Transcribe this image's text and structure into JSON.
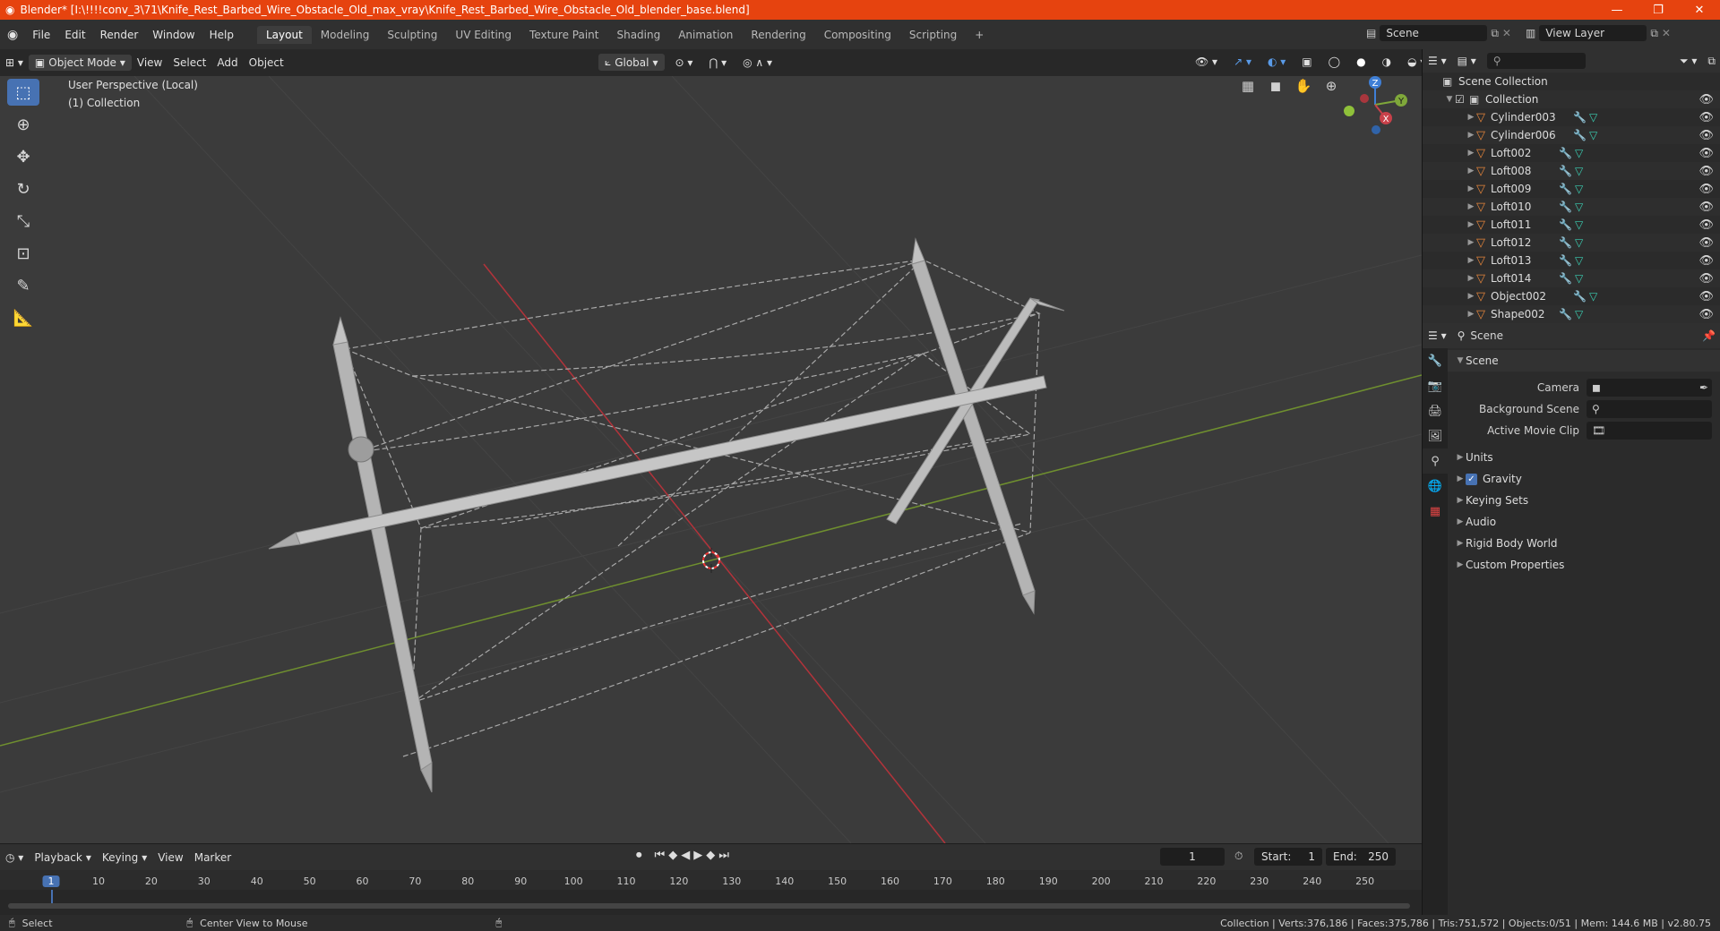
{
  "titlebar": {
    "title": "Blender* [I:\\!!!!conv_3\\71\\Knife_Rest_Barbed_Wire_Obstacle_Old_max_vray\\Knife_Rest_Barbed_Wire_Obstacle_Old_blender_base.blend]",
    "minimize": "—",
    "maximize": "❐",
    "close": "✕"
  },
  "menubar": {
    "items": [
      "File",
      "Edit",
      "Render",
      "Window",
      "Help"
    ],
    "workspaces": [
      "Layout",
      "Modeling",
      "Sculpting",
      "UV Editing",
      "Texture Paint",
      "Shading",
      "Animation",
      "Rendering",
      "Compositing",
      "Scripting"
    ],
    "add_workspace": "+",
    "scene_label": "Scene",
    "view_layer_label": "View Layer"
  },
  "viewport_header": {
    "mode": "Object Mode",
    "menus": [
      "View",
      "Select",
      "Add",
      "Object"
    ],
    "orientation": "Global"
  },
  "viewport": {
    "perspective": "User Perspective (Local)",
    "collection": "(1) Collection",
    "gizmo": {
      "z": "Z",
      "y": "Y",
      "x": "X"
    }
  },
  "outliner": {
    "root": "Scene Collection",
    "collection": "Collection",
    "objects": [
      "Cylinder003",
      "Cylinder006",
      "Loft002",
      "Loft008",
      "Loft009",
      "Loft010",
      "Loft011",
      "Loft012",
      "Loft013",
      "Loft014",
      "Object002",
      "Shape002"
    ]
  },
  "properties": {
    "header": "Scene",
    "panel_title": "Scene",
    "fields": [
      {
        "label": "Camera",
        "value": ""
      },
      {
        "label": "Background Scene",
        "value": ""
      },
      {
        "label": "Active Movie Clip",
        "value": ""
      }
    ],
    "sections": [
      "Units",
      "Gravity",
      "Keying Sets",
      "Audio",
      "Rigid Body World",
      "Custom Properties"
    ],
    "gravity_checked": true
  },
  "timeline": {
    "menus": [
      "Playback",
      "Keying",
      "View",
      "Marker"
    ],
    "current_frame": "1",
    "start_label": "Start:",
    "start": "1",
    "end_label": "End:",
    "end": "250",
    "ticks": [
      "1",
      "10",
      "20",
      "30",
      "40",
      "50",
      "60",
      "70",
      "80",
      "90",
      "100",
      "110",
      "120",
      "130",
      "140",
      "150",
      "160",
      "170",
      "180",
      "190",
      "200",
      "210",
      "220",
      "230",
      "240",
      "250"
    ]
  },
  "statusbar": {
    "select": "Select",
    "center_view": "Center View to Mouse",
    "stats": "Collection | Verts:376,186 | Faces:375,786 | Tris:751,572 | Objects:0/51 | Mem: 144.6 MB | v2.80.75"
  },
  "colors": {
    "titlebar": "#e6430f",
    "accent": "#4772b3",
    "x_axis": "#c8414a",
    "y_axis": "#7fa83a",
    "z_axis": "#3f7fd6"
  }
}
